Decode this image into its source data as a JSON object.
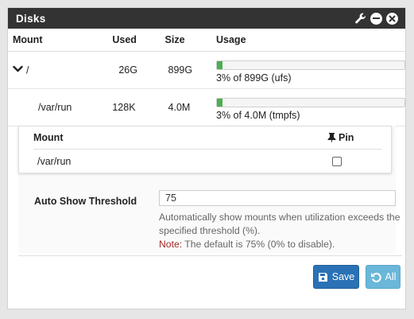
{
  "panel": {
    "title": "Disks"
  },
  "disks_table": {
    "headers": {
      "mount": "Mount",
      "used": "Used",
      "size": "Size",
      "usage": "Usage"
    },
    "rows": [
      {
        "mount": "/",
        "used": "26G",
        "size": "899G",
        "usage_text": "3% of 899G (ufs)",
        "usage_percent": 3,
        "expandable": true
      },
      {
        "mount": "/var/run",
        "used": "128K",
        "size": "4.0M",
        "usage_text": "3% of 4.0M (tmpfs)",
        "usage_percent": 3,
        "expandable": false
      }
    ]
  },
  "pin_table": {
    "headers": {
      "mount": "Mount",
      "pin": "Pin"
    },
    "rows": [
      {
        "mount": "/var/run",
        "pinned": false
      }
    ]
  },
  "threshold": {
    "label": "Auto Show Threshold",
    "value": "75",
    "help": "Automatically show mounts when utilization exceeds the specified threshold (%).",
    "note_label": "Note:",
    "note_text": " The default is 75% (0% to disable)."
  },
  "buttons": {
    "save": "Save",
    "all": "All"
  },
  "colors": {
    "heading_bg": "#333333",
    "usage_fill": "#4caf50",
    "save_bg": "#2a72b5",
    "all_bg": "#6ab7d9",
    "note": "#a32828"
  },
  "icons": {
    "wrench": "wrench-icon",
    "minimize": "minimize-icon",
    "close": "close-icon",
    "expand": "chevron-down-icon",
    "pin": "thumbtack-icon",
    "save": "save-icon",
    "reset": "undo-icon"
  }
}
